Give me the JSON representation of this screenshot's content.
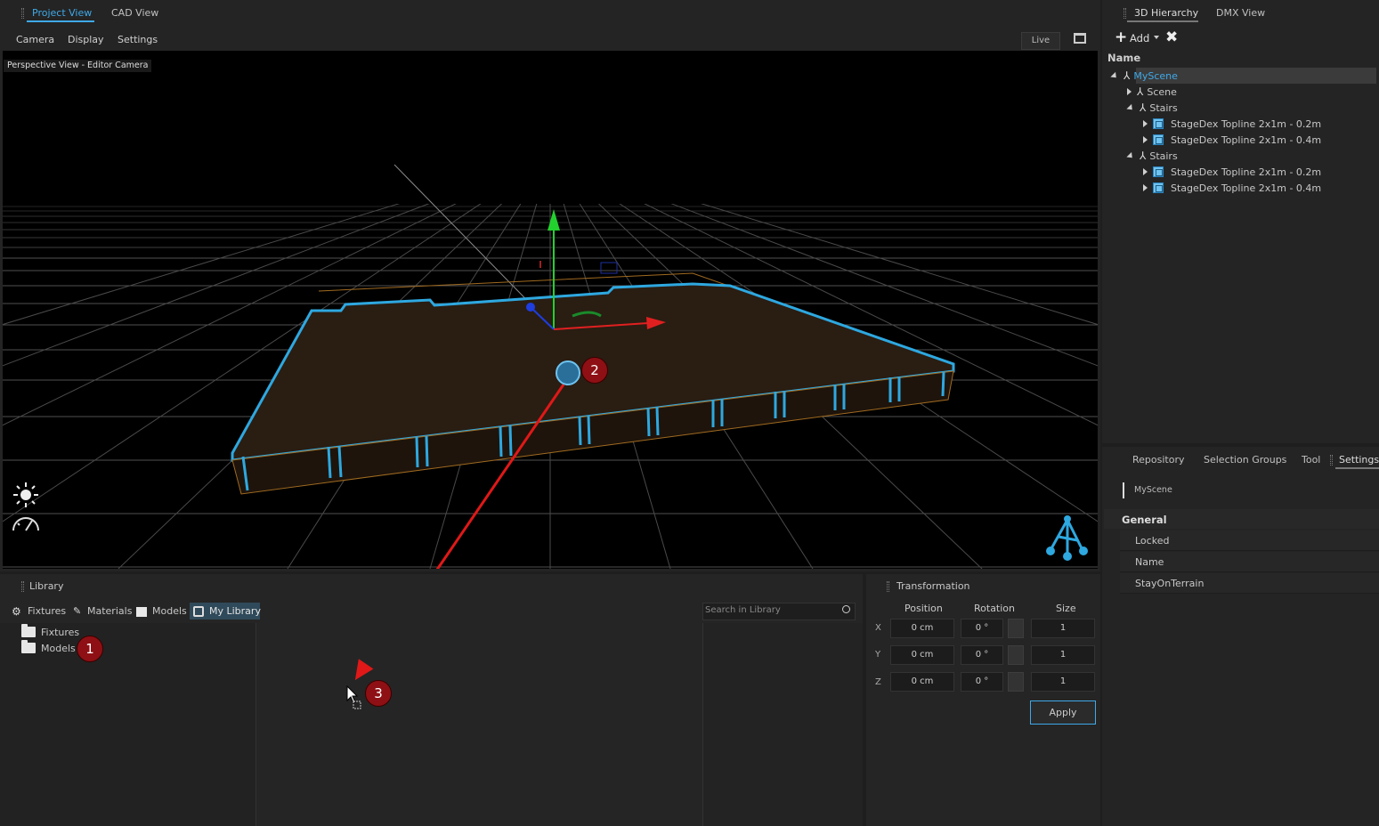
{
  "left_top_tabs": [
    "Project View",
    "CAD View"
  ],
  "viewport_menu": [
    "Camera",
    "Display",
    "Settings"
  ],
  "live_button": "Live",
  "viewport_label": "Perspective View - Editor Camera",
  "hierarchy": {
    "tabs": [
      "3D Hierarchy",
      "DMX View"
    ],
    "add_label": "Add",
    "column_header": "Name",
    "rows": [
      {
        "label": "MyScene",
        "level": 0,
        "expanded": true,
        "kind": "group",
        "selected": true
      },
      {
        "label": "Scene",
        "level": 1,
        "expanded": false,
        "kind": "group"
      },
      {
        "label": "Stairs",
        "level": 1,
        "expanded": true,
        "kind": "group"
      },
      {
        "label": "StageDex Topline 2x1m - 0.2m",
        "level": 2,
        "expanded": false,
        "kind": "model"
      },
      {
        "label": "StageDex Topline 2x1m - 0.4m",
        "level": 2,
        "expanded": false,
        "kind": "model"
      },
      {
        "label": "Stairs",
        "level": 1,
        "expanded": true,
        "kind": "group"
      },
      {
        "label": "StageDex Topline 2x1m - 0.2m",
        "level": 2,
        "expanded": false,
        "kind": "model"
      },
      {
        "label": "StageDex Topline 2x1m - 0.4m",
        "level": 2,
        "expanded": false,
        "kind": "model"
      }
    ]
  },
  "props": {
    "tabs": [
      "Repository",
      "Selection Groups",
      "Tool",
      "Settings"
    ],
    "scene_name": "MyScene",
    "section": "General",
    "fields": [
      "Locked",
      "Name",
      "StayOnTerrain"
    ]
  },
  "library": {
    "title": "Library",
    "tabs": [
      "Fixtures",
      "Materials",
      "Models",
      "My Library"
    ],
    "search_placeholder": "Search in Library",
    "folders": [
      "Fixtures",
      "Models"
    ]
  },
  "transformation": {
    "title": "Transformation",
    "headers": [
      "Position",
      "Rotation",
      "Size"
    ],
    "rows": [
      {
        "axis": "X",
        "position": "0 cm",
        "rotation": "0 °",
        "size": "1"
      },
      {
        "axis": "Y",
        "position": "0 cm",
        "rotation": "0 °",
        "size": "1"
      },
      {
        "axis": "Z",
        "position": "0 cm",
        "rotation": "0 °",
        "size": "1"
      }
    ],
    "apply_label": "Apply"
  },
  "annotations": [
    "1",
    "2",
    "3"
  ],
  "colors": {
    "accent": "#3fa9e8",
    "stage_outline": "#2ea8e0",
    "annotation": "#8e1014",
    "arrow": "#e01818"
  }
}
